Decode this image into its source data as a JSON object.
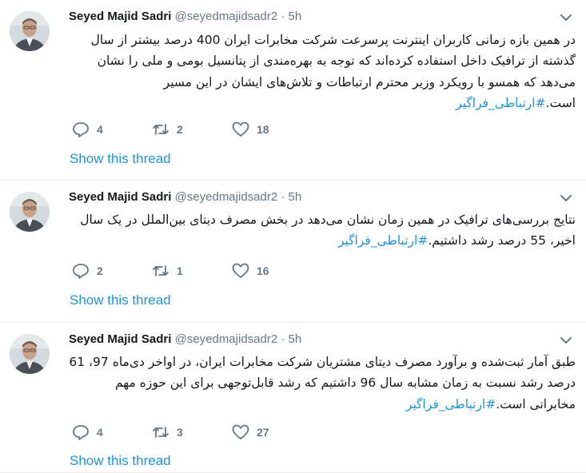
{
  "colors": {
    "link": "#1b95e0",
    "muted": "#657786",
    "text": "#14171a",
    "divider": "#e6ecf0"
  },
  "tweets": [
    {
      "author_name": "Seyed Majid Sadri",
      "handle": "@seyedmajidsadr2",
      "separator": "·",
      "time": "5h",
      "body": "در همین بازه زمانی کاربران اینترنت پرسرعت شرکت مخابرات ایران 400 درصد بیشتر از سال گذشته از ترافیک داخل استفاده کرده‌اند که توجه به بهره‌مندی از پتانسیل بومی و ملی را نشان می‌دهد که همسو با رویکرد وزیر محترم ارتباطات و تلاش‌های ایشان در این مسیر است.",
      "hashtag": "#ارتباطی_فراگیر",
      "replies": "4",
      "retweets": "2",
      "likes": "18",
      "thread_label": "Show this thread",
      "menu_icon": "chevron-down-icon"
    },
    {
      "author_name": "Seyed Majid Sadri",
      "handle": "@seyedmajidsadr2",
      "separator": "·",
      "time": "5h",
      "body": "نتایج بررسی‌های ترافیک در همین زمان نشان می‌دهد در بخش مصرف دیتای بین‌الملل در یک سال اخیر، 55 درصد رشد داشتیم.",
      "hashtag": "#ارتباطی_فراگیر",
      "replies": "2",
      "retweets": "1",
      "likes": "16",
      "thread_label": "Show this thread",
      "menu_icon": "chevron-down-icon"
    },
    {
      "author_name": "Seyed Majid Sadri",
      "handle": "@seyedmajidsadr2",
      "separator": "·",
      "time": "5h",
      "body": "طبق آمار ثبت‌شده و برآورد مصرف دیتای مشتریان شرکت مخابرات ایران، در اواخر دی‌ماه 97، 61 درصد رشد نسبت به زمان مشابه سال 96 داشتیم که رشد قابل‌توجهی برای این حوزه مهم مخابراتی است.",
      "hashtag": "#ارتباطی_فراگیر",
      "replies": "4",
      "retweets": "3",
      "likes": "27",
      "thread_label": "Show this thread",
      "menu_icon": "chevron-down-icon"
    }
  ]
}
